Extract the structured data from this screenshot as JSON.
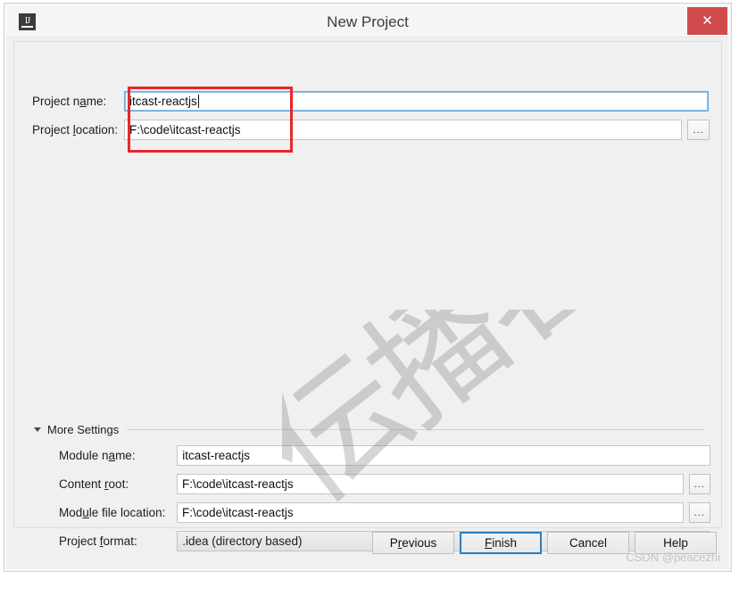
{
  "window": {
    "title": "New Project",
    "app_icon": "intellij-idea-icon",
    "close_icon": "close-icon",
    "close_bg": "#cf4c4c"
  },
  "top_fields": {
    "project_name": {
      "label_pre": "Project n",
      "label_mnemonic": "a",
      "label_post": "me:",
      "value": "itcast-reactjs",
      "focused": true
    },
    "project_location": {
      "label_pre": "Project ",
      "label_mnemonic": "l",
      "label_post": "ocation:",
      "value": "F:\\code\\itcast-reactjs",
      "browse_label": "..."
    }
  },
  "annotation": {
    "type": "red-rectangle-highlight",
    "color": "#e8262c"
  },
  "more_settings": {
    "label_pre": "More S",
    "label_mnemonic": "",
    "label_post": "ettings",
    "label": "More Settings",
    "expanded": true,
    "triangle_icon": "triangle-down-icon",
    "rows": [
      {
        "name": "module-name",
        "label_pre": "Module n",
        "label_mnemonic": "a",
        "label_post": "me:",
        "value": "itcast-reactjs",
        "has_browse": false
      },
      {
        "name": "content-root",
        "label_pre": "Content ",
        "label_mnemonic": "r",
        "label_post": "oot:",
        "value": "F:\\code\\itcast-reactjs",
        "has_browse": true,
        "browse_label": "..."
      },
      {
        "name": "module-file-location",
        "label_pre": "Mod",
        "label_mnemonic": "u",
        "label_post": "le file location:",
        "value": "F:\\code\\itcast-reactjs",
        "has_browse": true,
        "browse_label": "..."
      }
    ],
    "project_format": {
      "label_pre": "Project ",
      "label_mnemonic": "f",
      "label_post": "ormat:",
      "value": ".idea (directory based)",
      "chevron_icon": "chevron-down-icon"
    }
  },
  "buttons": [
    {
      "name": "previous",
      "pre": "P",
      "mnemonic": "r",
      "post": "evious",
      "focused": false
    },
    {
      "name": "finish",
      "pre": "",
      "mnemonic": "F",
      "post": "inish",
      "focused": true
    },
    {
      "name": "cancel",
      "pre": "Cancel",
      "mnemonic": "",
      "post": "",
      "focused": false
    },
    {
      "name": "help",
      "pre": "Help",
      "mnemonic": "",
      "post": "",
      "focused": false
    }
  ],
  "watermarks": {
    "cjk_line1": "伝",
    "cjk_line2": "播",
    "cjk_line3": "客",
    "credit": "CSDN @peacezhi"
  }
}
